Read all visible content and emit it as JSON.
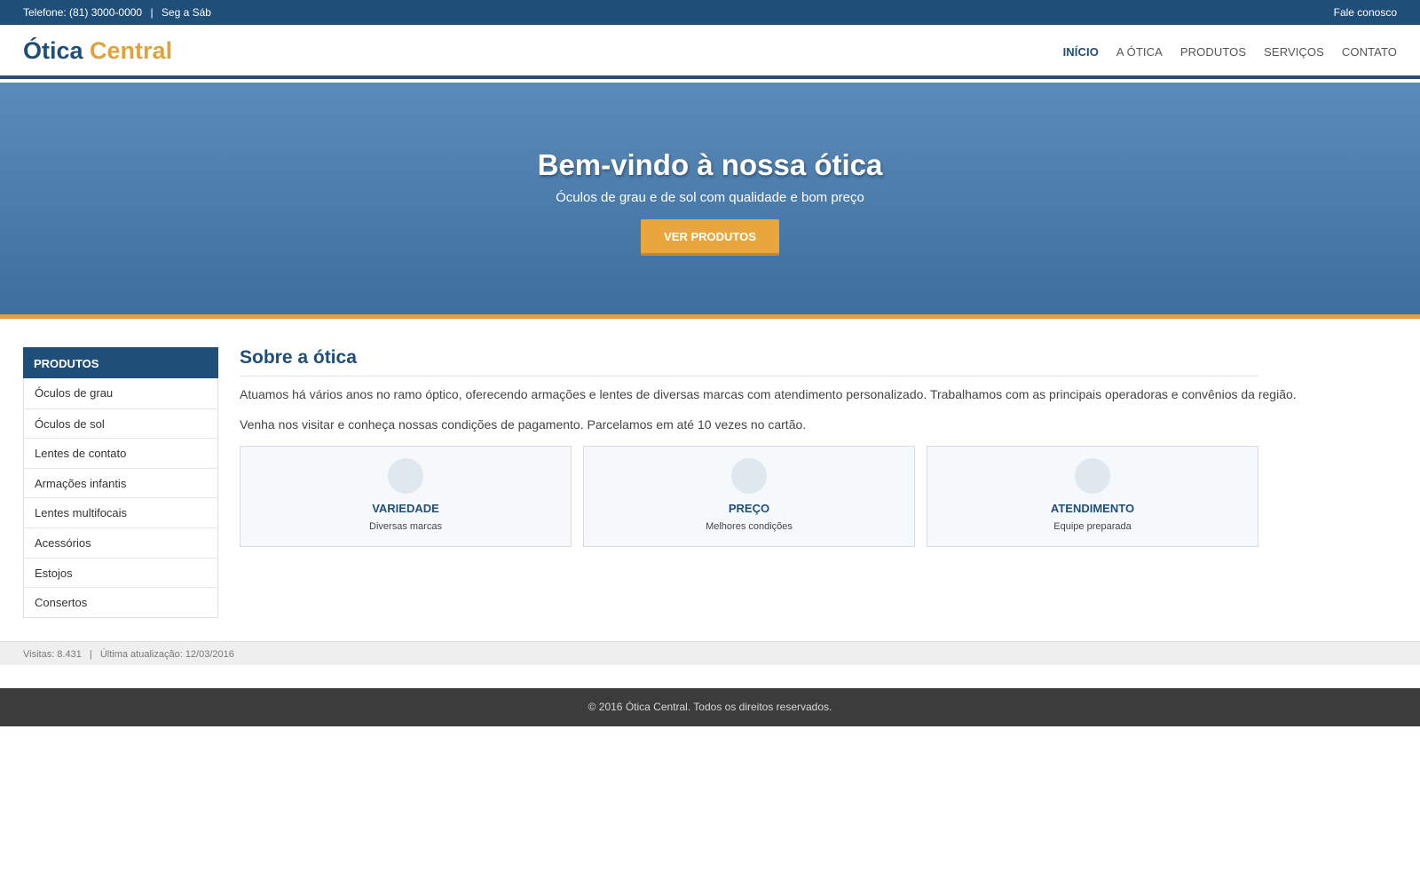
{
  "topbar": {
    "phone": "Telefone: (81) 3000-0000",
    "separator": "|",
    "hours": "Seg a Sáb",
    "contact_link": "Fale conosco"
  },
  "header": {
    "logo_main": "Ótica",
    "logo_accent": "Central",
    "nav": [
      "INÍCIO",
      "A ÓTICA",
      "PRODUTOS",
      "SERVIÇOS",
      "CONTATO"
    ]
  },
  "hero": {
    "title": "Bem-vindo à nossa ótica",
    "subtitle": "Óculos de grau e de sol com qualidade e bom preço",
    "cta": "VER PRODUTOS"
  },
  "sidebar": {
    "title": "PRODUTOS",
    "items": [
      "Óculos de grau",
      "Óculos de sol",
      "Lentes de contato",
      "Armações infantis",
      "Lentes multifocais",
      "Acessórios",
      "Estojos",
      "Consertos"
    ]
  },
  "content": {
    "title": "Sobre a ótica",
    "paragraph1": "Atuamos há vários anos no ramo óptico, oferecendo armações e lentes de diversas marcas com atendimento personalizado. Trabalhamos com as principais operadoras e convênios da região.",
    "paragraph2": "Venha nos visitar e conheça nossas condições de pagamento. Parcelamos em até 10 vezes no cartão.",
    "cards": [
      {
        "title": "VARIEDADE",
        "subtitle": "Diversas marcas"
      },
      {
        "title": "PREÇO",
        "subtitle": "Melhores condições"
      },
      {
        "title": "ATENDIMENTO",
        "subtitle": "Equipe preparada"
      }
    ]
  },
  "statusbar": {
    "visits": "Visitas: 8.431",
    "separator": "|",
    "updated": "Última atualização: 12/03/2016"
  },
  "footer": {
    "copyright": "© 2016 Ótica Central. Todos os direitos reservados."
  },
  "colors": {
    "primary": "#1f4e79",
    "accent": "#e0a33c",
    "footer_bg": "#3c3c3c"
  }
}
